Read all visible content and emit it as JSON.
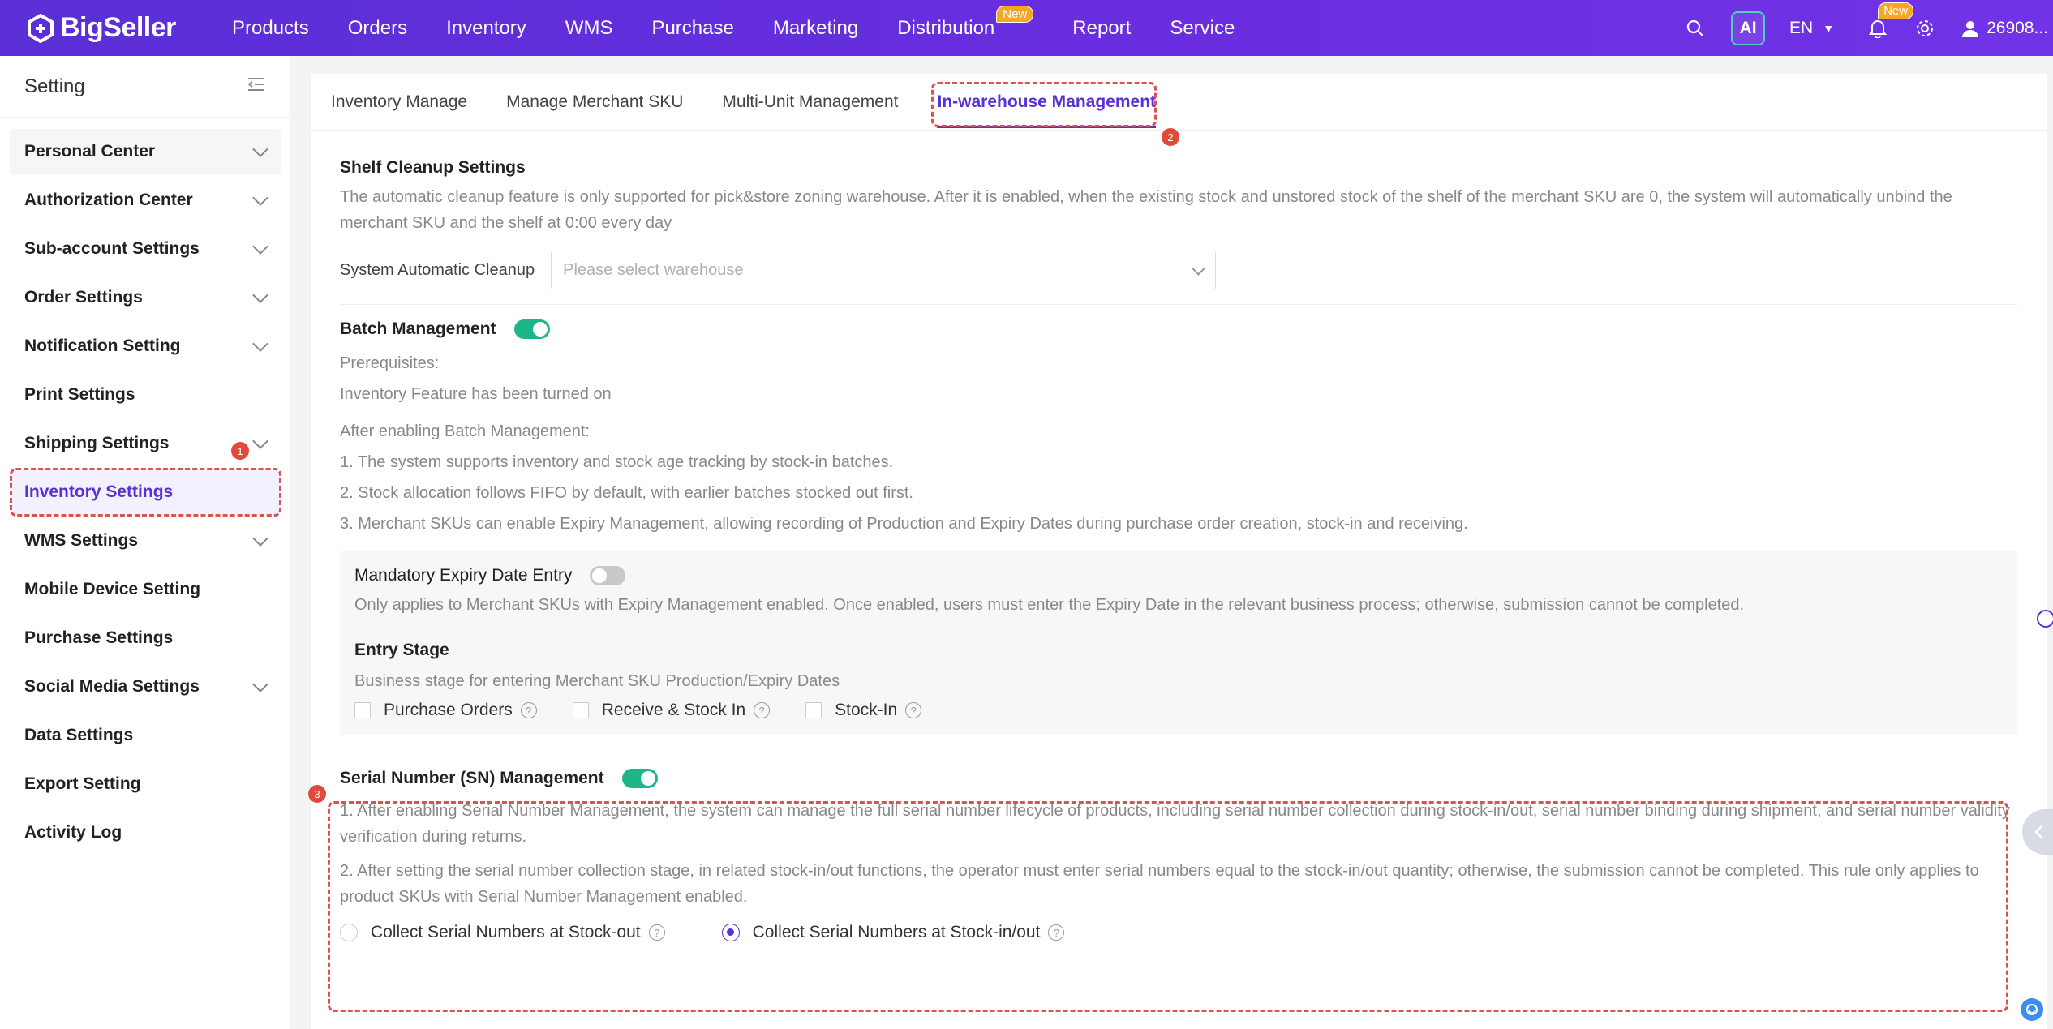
{
  "app": {
    "brand": "BigSeller"
  },
  "nav": {
    "items": [
      "Products",
      "Orders",
      "Inventory",
      "WMS",
      "Purchase",
      "Marketing",
      "Distribution",
      "Report",
      "Service"
    ],
    "distribution_badge": "New"
  },
  "topbar": {
    "ai_label": "AI",
    "lang": "EN",
    "bell_badge": "New",
    "user": "26908..."
  },
  "sidebar": {
    "title": "Setting",
    "items": [
      "Personal Center",
      "Authorization Center",
      "Sub-account Settings",
      "Order Settings",
      "Notification Setting",
      "Print Settings",
      "Shipping Settings",
      "Inventory Settings",
      "WMS Settings",
      "Mobile Device Setting",
      "Purchase Settings",
      "Social Media Settings",
      "Data Settings",
      "Export Setting",
      "Activity Log"
    ]
  },
  "steps": {
    "one": "1",
    "two": "2",
    "three": "3"
  },
  "tabs": [
    "Inventory Manage",
    "Manage Merchant SKU",
    "Multi-Unit Management",
    "In-warehouse Management"
  ],
  "shelf": {
    "title": "Shelf Cleanup Settings",
    "desc": "The automatic cleanup feature is only supported for pick&store zoning warehouse. After it is enabled, when the existing stock and unstored stock of the shelf of the merchant SKU are 0, the system will automatically unbind the merchant SKU and the shelf at 0:00 every day",
    "label": "System Automatic Cleanup",
    "placeholder": "Please select warehouse"
  },
  "batch": {
    "title": "Batch Management",
    "prereq_title": "Prerequisites:",
    "prereq": "Inventory Feature has been turned on",
    "after_title": "After enabling Batch Management:",
    "points": [
      "1. The system supports inventory and stock age tracking by stock-in batches.",
      "2. Stock allocation follows FIFO by default, with earlier batches stocked out first.",
      "3. Merchant SKUs can enable Expiry Management, allowing recording of Production and Expiry Dates during purchase order creation, stock-in and receiving."
    ],
    "mandatory_title": "Mandatory Expiry Date Entry",
    "mandatory_desc": "Only applies to Merchant SKUs with Expiry Management enabled. Once enabled, users must enter the Expiry Date in the relevant business process; otherwise, submission cannot be completed.",
    "entry_title": "Entry Stage",
    "entry_desc": "Business stage for entering Merchant SKU Production/Expiry Dates",
    "entry_options": [
      "Purchase Orders",
      "Receive & Stock In",
      "Stock-In"
    ]
  },
  "sn": {
    "title": "Serial Number (SN) Management",
    "point1": "1. After enabling Serial Number Management, the system can manage the full serial number lifecycle of products, including serial number collection during stock-in/out, serial number binding during shipment, and serial number validity verification during returns.",
    "point2": "2. After setting the serial number collection stage, in related stock-in/out functions, the operator must enter serial numbers equal to the stock-in/out quantity; otherwise, the submission cannot be completed. This rule only applies to product SKUs with Serial Number Management enabled.",
    "options": [
      "Collect Serial Numbers at Stock-out",
      "Collect Serial Numbers at Stock-in/out"
    ]
  },
  "colors": {
    "brand": "#5a2fd6",
    "toggle_on": "#1fb58b",
    "annotation": "#d9534f"
  }
}
